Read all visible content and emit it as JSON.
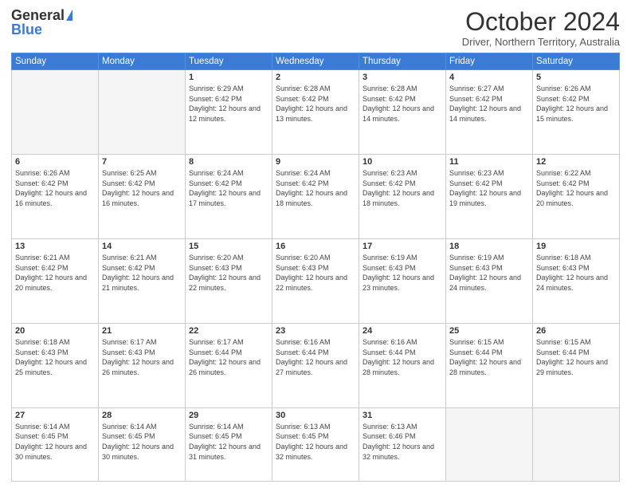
{
  "header": {
    "logo_general": "General",
    "logo_blue": "Blue",
    "month_title": "October 2024",
    "location": "Driver, Northern Territory, Australia"
  },
  "weekdays": [
    "Sunday",
    "Monday",
    "Tuesday",
    "Wednesday",
    "Thursday",
    "Friday",
    "Saturday"
  ],
  "weeks": [
    [
      {
        "day": "",
        "info": ""
      },
      {
        "day": "",
        "info": ""
      },
      {
        "day": "1",
        "info": "Sunrise: 6:29 AM\nSunset: 6:42 PM\nDaylight: 12 hours and 12 minutes."
      },
      {
        "day": "2",
        "info": "Sunrise: 6:28 AM\nSunset: 6:42 PM\nDaylight: 12 hours and 13 minutes."
      },
      {
        "day": "3",
        "info": "Sunrise: 6:28 AM\nSunset: 6:42 PM\nDaylight: 12 hours and 14 minutes."
      },
      {
        "day": "4",
        "info": "Sunrise: 6:27 AM\nSunset: 6:42 PM\nDaylight: 12 hours and 14 minutes."
      },
      {
        "day": "5",
        "info": "Sunrise: 6:26 AM\nSunset: 6:42 PM\nDaylight: 12 hours and 15 minutes."
      }
    ],
    [
      {
        "day": "6",
        "info": "Sunrise: 6:26 AM\nSunset: 6:42 PM\nDaylight: 12 hours and 16 minutes."
      },
      {
        "day": "7",
        "info": "Sunrise: 6:25 AM\nSunset: 6:42 PM\nDaylight: 12 hours and 16 minutes."
      },
      {
        "day": "8",
        "info": "Sunrise: 6:24 AM\nSunset: 6:42 PM\nDaylight: 12 hours and 17 minutes."
      },
      {
        "day": "9",
        "info": "Sunrise: 6:24 AM\nSunset: 6:42 PM\nDaylight: 12 hours and 18 minutes."
      },
      {
        "day": "10",
        "info": "Sunrise: 6:23 AM\nSunset: 6:42 PM\nDaylight: 12 hours and 18 minutes."
      },
      {
        "day": "11",
        "info": "Sunrise: 6:23 AM\nSunset: 6:42 PM\nDaylight: 12 hours and 19 minutes."
      },
      {
        "day": "12",
        "info": "Sunrise: 6:22 AM\nSunset: 6:42 PM\nDaylight: 12 hours and 20 minutes."
      }
    ],
    [
      {
        "day": "13",
        "info": "Sunrise: 6:21 AM\nSunset: 6:42 PM\nDaylight: 12 hours and 20 minutes."
      },
      {
        "day": "14",
        "info": "Sunrise: 6:21 AM\nSunset: 6:42 PM\nDaylight: 12 hours and 21 minutes."
      },
      {
        "day": "15",
        "info": "Sunrise: 6:20 AM\nSunset: 6:43 PM\nDaylight: 12 hours and 22 minutes."
      },
      {
        "day": "16",
        "info": "Sunrise: 6:20 AM\nSunset: 6:43 PM\nDaylight: 12 hours and 22 minutes."
      },
      {
        "day": "17",
        "info": "Sunrise: 6:19 AM\nSunset: 6:43 PM\nDaylight: 12 hours and 23 minutes."
      },
      {
        "day": "18",
        "info": "Sunrise: 6:19 AM\nSunset: 6:43 PM\nDaylight: 12 hours and 24 minutes."
      },
      {
        "day": "19",
        "info": "Sunrise: 6:18 AM\nSunset: 6:43 PM\nDaylight: 12 hours and 24 minutes."
      }
    ],
    [
      {
        "day": "20",
        "info": "Sunrise: 6:18 AM\nSunset: 6:43 PM\nDaylight: 12 hours and 25 minutes."
      },
      {
        "day": "21",
        "info": "Sunrise: 6:17 AM\nSunset: 6:43 PM\nDaylight: 12 hours and 26 minutes."
      },
      {
        "day": "22",
        "info": "Sunrise: 6:17 AM\nSunset: 6:44 PM\nDaylight: 12 hours and 26 minutes."
      },
      {
        "day": "23",
        "info": "Sunrise: 6:16 AM\nSunset: 6:44 PM\nDaylight: 12 hours and 27 minutes."
      },
      {
        "day": "24",
        "info": "Sunrise: 6:16 AM\nSunset: 6:44 PM\nDaylight: 12 hours and 28 minutes."
      },
      {
        "day": "25",
        "info": "Sunrise: 6:15 AM\nSunset: 6:44 PM\nDaylight: 12 hours and 28 minutes."
      },
      {
        "day": "26",
        "info": "Sunrise: 6:15 AM\nSunset: 6:44 PM\nDaylight: 12 hours and 29 minutes."
      }
    ],
    [
      {
        "day": "27",
        "info": "Sunrise: 6:14 AM\nSunset: 6:45 PM\nDaylight: 12 hours and 30 minutes."
      },
      {
        "day": "28",
        "info": "Sunrise: 6:14 AM\nSunset: 6:45 PM\nDaylight: 12 hours and 30 minutes."
      },
      {
        "day": "29",
        "info": "Sunrise: 6:14 AM\nSunset: 6:45 PM\nDaylight: 12 hours and 31 minutes."
      },
      {
        "day": "30",
        "info": "Sunrise: 6:13 AM\nSunset: 6:45 PM\nDaylight: 12 hours and 32 minutes."
      },
      {
        "day": "31",
        "info": "Sunrise: 6:13 AM\nSunset: 6:46 PM\nDaylight: 12 hours and 32 minutes."
      },
      {
        "day": "",
        "info": ""
      },
      {
        "day": "",
        "info": ""
      }
    ]
  ]
}
